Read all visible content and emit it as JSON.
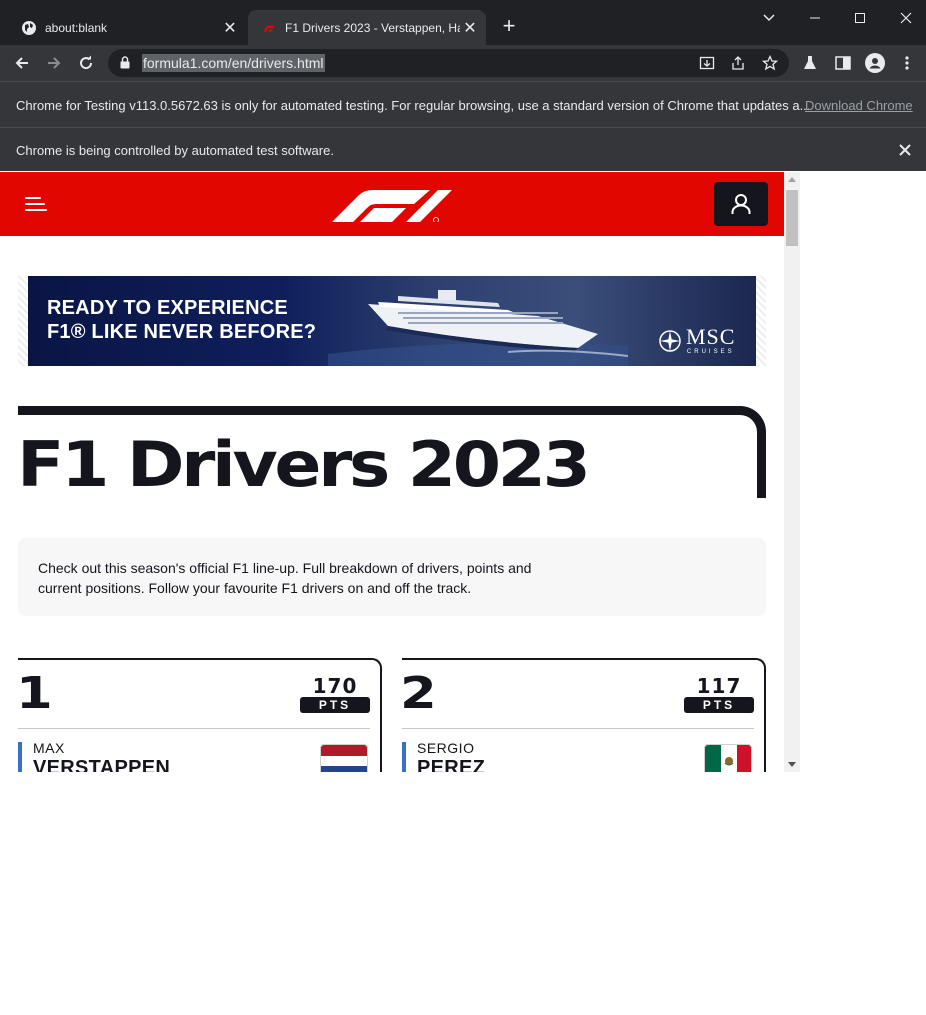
{
  "browser": {
    "tabs": [
      {
        "title": "about:blank",
        "active": false
      },
      {
        "title": "F1 Drivers 2023 - Verstappen, Ha",
        "active": true
      }
    ],
    "url": "formula1.com/en/drivers.html",
    "infobars": {
      "testing_message": "Chrome for Testing v113.0.5672.63 is only for automated testing. For regular browsing, use a standard version of Chrome that updates a...",
      "testing_link": "Download Chrome",
      "automation_message": "Chrome is being controlled by automated test software."
    }
  },
  "page": {
    "ad": {
      "headline_line1": "READY TO EXPERIENCE",
      "headline_line2": "F1® LIKE NEVER BEFORE?",
      "brand": "MSC",
      "brand_sub": "CRUISES"
    },
    "title": "F1 Drivers 2023",
    "intro": "Check out this season's official F1 line-up. Full breakdown of drivers, points and current positions. Follow your favourite F1 drivers on and off the track.",
    "drivers": [
      {
        "rank": "1",
        "points": "170",
        "points_label": "PTS",
        "first_name": "MAX",
        "last_name": "VERSTAPPEN",
        "team_color": "#3671c6",
        "flag": "netherlands-flag"
      },
      {
        "rank": "2",
        "points": "117",
        "points_label": "PTS",
        "first_name": "SERGIO",
        "last_name": "PEREZ",
        "team_color": "#3671c6",
        "flag": "mexico-flag"
      }
    ]
  },
  "colors": {
    "f1_red": "#e10600",
    "f1_dark": "#15151e",
    "chrome_dark": "#202124",
    "chrome_toolbar": "#35363a"
  }
}
